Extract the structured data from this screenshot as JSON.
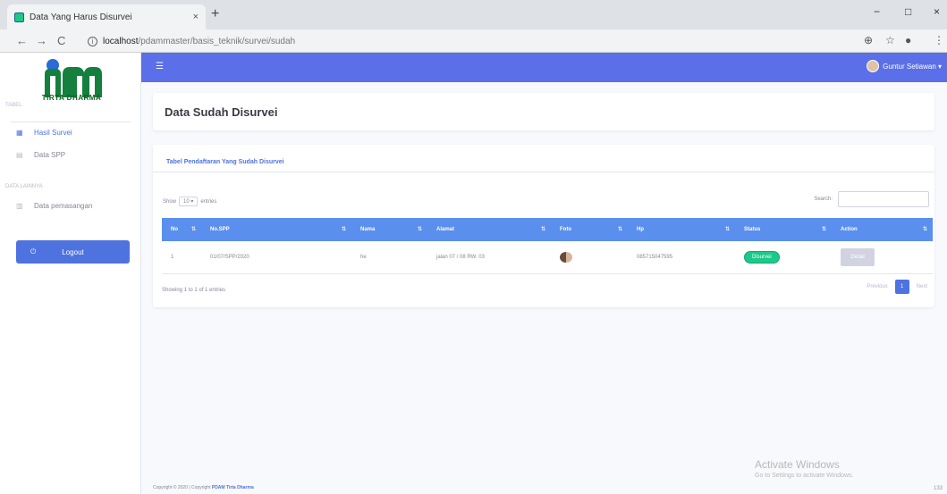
{
  "browser": {
    "tab_title": "Data Yang Harus Disurvei",
    "tab_close": "×",
    "new_tab": "+",
    "url_host": "localhost",
    "url_path": "/pdammaster/basis_teknik/survei/sudah",
    "back": "←",
    "forward": "→",
    "reload": "C",
    "min": "−",
    "max": "□",
    "close": "×"
  },
  "sidebar": {
    "brand": "TIRTA DHARMA",
    "heading1": "tabel",
    "heading2": "data lainnya",
    "items": [
      {
        "label": "Hasil Survei",
        "icon": "table-icon",
        "active": true
      },
      {
        "label": "Data SPP",
        "icon": "file-icon",
        "active": false
      },
      {
        "label": "Data pemasangan",
        "icon": "list-icon",
        "active": false
      }
    ],
    "logout": "Logout"
  },
  "topbar": {
    "toggle": "☰",
    "user_name": "Guntur Setiawan ▾"
  },
  "page": {
    "title": "Data Sudah Disurvei"
  },
  "table_card": {
    "heading": "Tabel Pendaftaran Yang Sudah Disurvei",
    "show_label": "Show",
    "entries_value": "10 ▾",
    "entries_label": "entries",
    "search_label": "Search:",
    "columns": [
      "No",
      "No.SPP",
      "Nama",
      "Alamat",
      "Foto",
      "Hp",
      "Status",
      "Action"
    ],
    "rows": [
      {
        "no": "1",
        "spp": "01/07/SPP/2020",
        "nama": "he",
        "alamat": "jalan 07 / 08 RW. 03",
        "hp": "085715047595",
        "status": "Disurvei",
        "action": "Detail"
      }
    ],
    "info": "Showing 1 to 1 of 1 entries",
    "prev": "Previous",
    "page": "1",
    "next": "Next"
  },
  "footer": {
    "text": "Copyright © 2020 | Copyright",
    "brand": "PDAM Tirta Dharma"
  },
  "watermark": {
    "line1": "Activate Windows",
    "line2": "Go to Settings to activate Windows."
  },
  "misc": {
    "bottom_num": "133"
  }
}
